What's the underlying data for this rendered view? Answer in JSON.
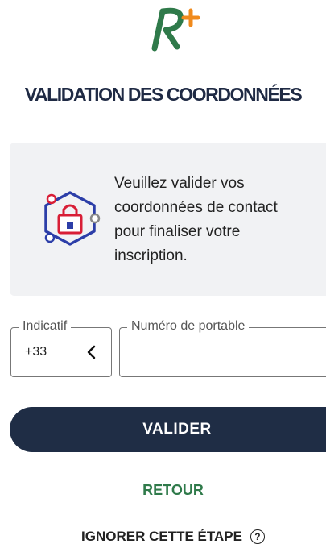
{
  "logo": {
    "name": "R+ logo"
  },
  "page": {
    "title": "VALIDATION DES COORDONNÉES"
  },
  "info": {
    "icon": "contact-lock-icon",
    "text": "Veuillez valider vos coordonnées de contact pour finaliser votre inscription."
  },
  "form": {
    "indicatif_label": "Indicatif",
    "indicatif_value": "+33",
    "phone_label": "Numéro de portable",
    "phone_value": ""
  },
  "actions": {
    "validate_label": "VALIDER",
    "back_label": "RETOUR",
    "skip_label": "IGNORER CETTE ÉTAPE",
    "help_symbol": "?"
  },
  "colors": {
    "primary": "#1f2d45",
    "green": "#2f7a4a",
    "orange": "#f08a1c",
    "card_bg": "#f1f2f4",
    "icon_blue": "#2c3ea8",
    "icon_red": "#d81e36"
  }
}
